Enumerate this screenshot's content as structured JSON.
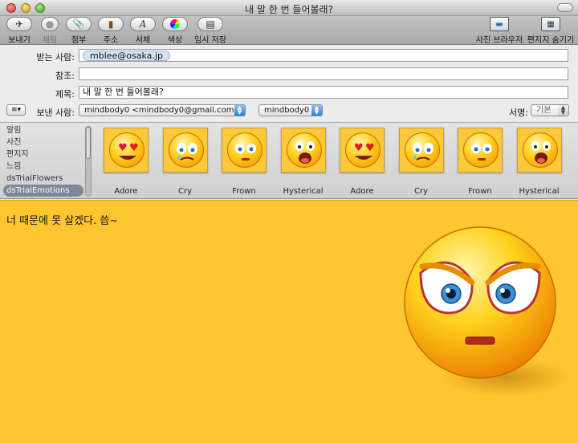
{
  "window": {
    "title": "내 말 한 번 들어볼래?"
  },
  "toolbar": {
    "send": "보내기",
    "chat": "채팅",
    "attach": "첨부",
    "address": "주소",
    "fonts": "서체",
    "colors": "색상",
    "save_draft": "임시 저장",
    "photo_browser": "사진 브라우저",
    "hide_stationery": "편지지 숨기기"
  },
  "headers": {
    "to_label": "받는 사람:",
    "to_token": "mblee@osaka.jp",
    "cc_label": "참조:",
    "cc_value": "",
    "subject_label": "제목:",
    "subject_value": "내 말 한 번 들어볼래?",
    "from_label": "보낸 사람:",
    "from_value": "mindbody0 <mindbody0@gmail.com>",
    "account_value": "mindbody0",
    "signature_label": "서명:",
    "signature_value": "기본",
    "action_menu": "≡▾"
  },
  "stationery": {
    "categories": [
      "알림",
      "사진",
      "편지지",
      "느낌",
      "dsTrialFlowers",
      "dsTrialEmotions"
    ],
    "selected_index": 5,
    "thumbnails": [
      {
        "name": "Adore",
        "expression": "heart-eyes"
      },
      {
        "name": "Cry",
        "expression": "cry"
      },
      {
        "name": "Frown",
        "expression": "frown"
      },
      {
        "name": "Hysterical",
        "expression": "hysterical"
      },
      {
        "name": "Adore",
        "expression": "heart-eyes"
      },
      {
        "name": "Cry",
        "expression": "cry"
      },
      {
        "name": "Frown",
        "expression": "frown"
      },
      {
        "name": "Hysterical",
        "expression": "hysterical"
      }
    ]
  },
  "body": {
    "text": "너 때문에 못 살겠다. 씁~"
  },
  "colors": {
    "stationery_bg": "#ffc62f",
    "selection": "#7d8896",
    "popup_blue": "#2f7fd8"
  }
}
